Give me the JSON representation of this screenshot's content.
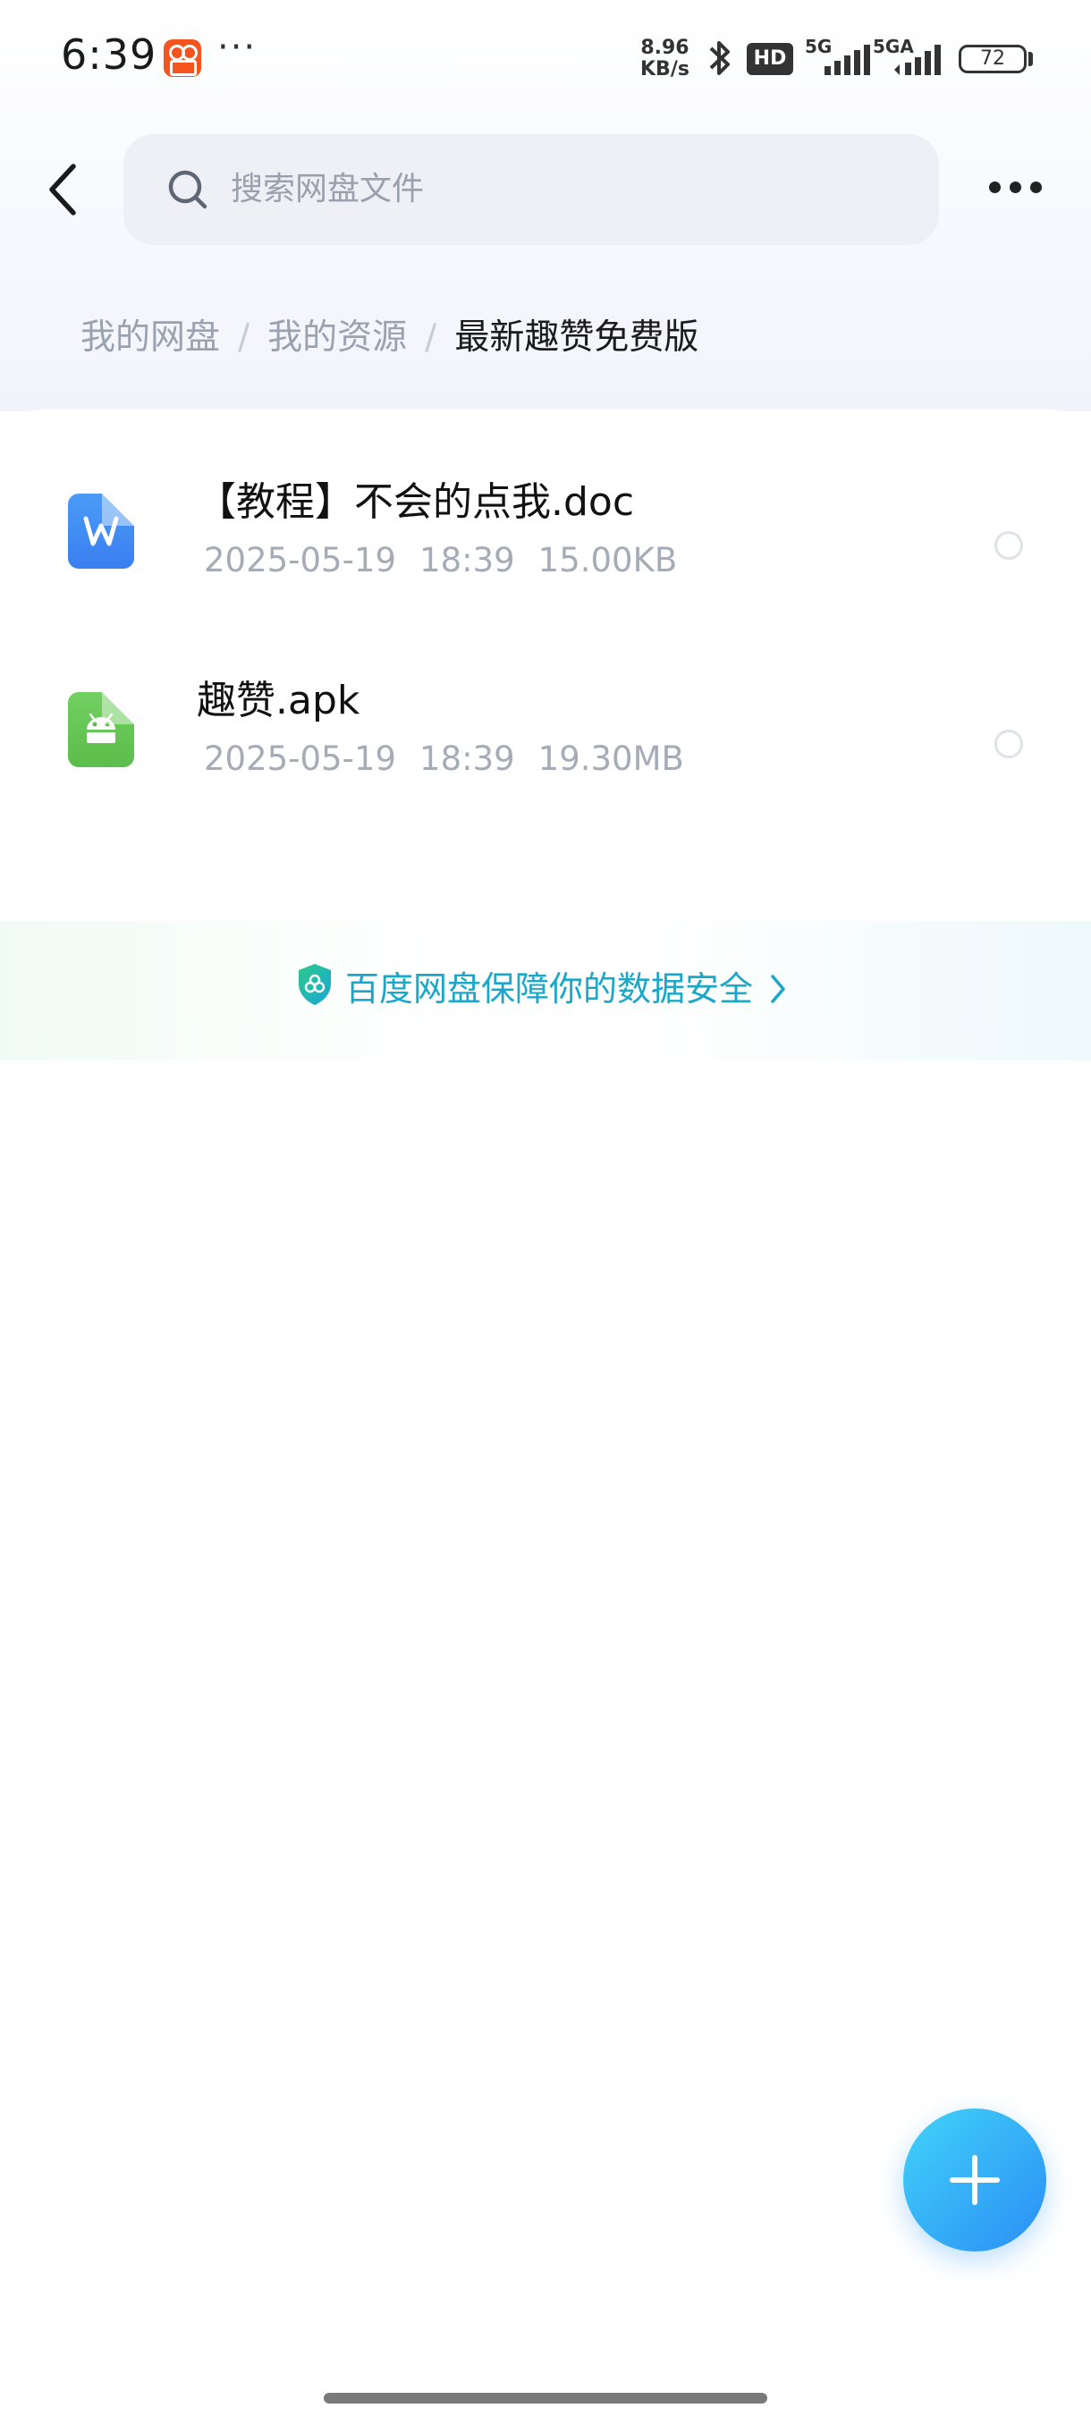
{
  "status_bar": {
    "time": "6:39",
    "more": "···",
    "net_speed_value": "8.96",
    "net_speed_unit": "KB/s",
    "hd": "HD",
    "sim1": "5G",
    "sim2": "5GA",
    "battery": "72"
  },
  "search": {
    "placeholder": "搜索网盘文件"
  },
  "breadcrumb": {
    "items": [
      "我的网盘",
      "我的资源"
    ],
    "current": "最新趣赞免费版",
    "separator": "/"
  },
  "files": [
    {
      "name": "【教程】不会的点我.doc",
      "date": "2025-05-19",
      "time": "18:39",
      "size": "15.00KB",
      "type_icon": "word-file-icon"
    },
    {
      "name": "趣赞.apk",
      "date": "2025-05-19",
      "time": "18:39",
      "size": "19.30MB",
      "type_icon": "apk-file-icon"
    }
  ],
  "security_banner": {
    "text": "百度网盘保障你的数据安全"
  },
  "colors": {
    "accent": "#2b8ef5",
    "security_text": "#1aa7c8",
    "word_icon": "#3a7ef0",
    "apk_icon": "#5bbd4b"
  }
}
